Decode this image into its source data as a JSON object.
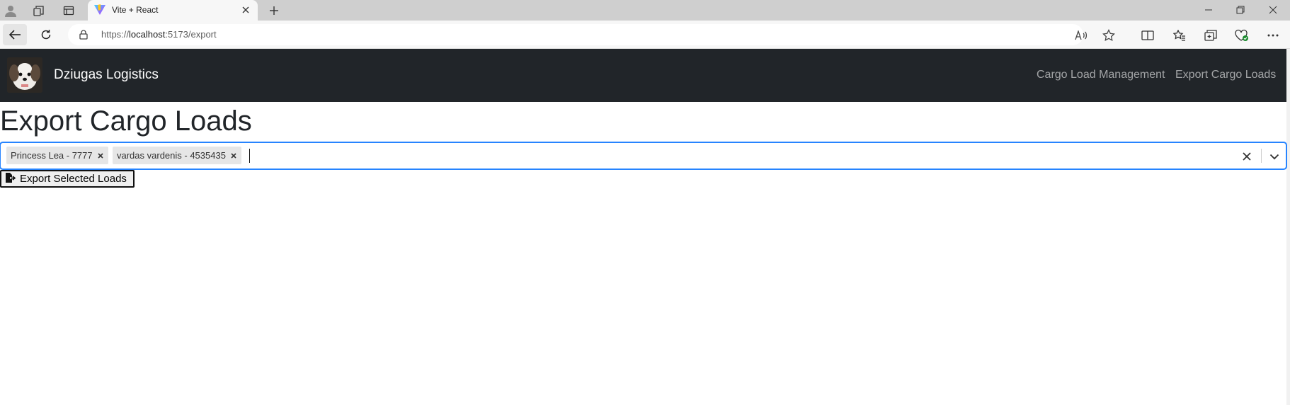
{
  "browser": {
    "tab_title": "Vite + React",
    "url_scheme": "https://",
    "url_host": "localhost",
    "url_rest": ":5173/export"
  },
  "navbar": {
    "brand_name": "Dziugas Logistics",
    "links": [
      {
        "label": "Cargo Load Management"
      },
      {
        "label": "Export Cargo Loads"
      }
    ]
  },
  "page": {
    "title": "Export Cargo Loads"
  },
  "load_select": {
    "selected": [
      {
        "label": "Princess Lea - 7777"
      },
      {
        "label": "vardas vardenis - 4535435"
      }
    ],
    "focus_color": "#2684ff"
  },
  "export_button": {
    "label": "Export Selected Loads",
    "icon": "file-export-icon"
  }
}
